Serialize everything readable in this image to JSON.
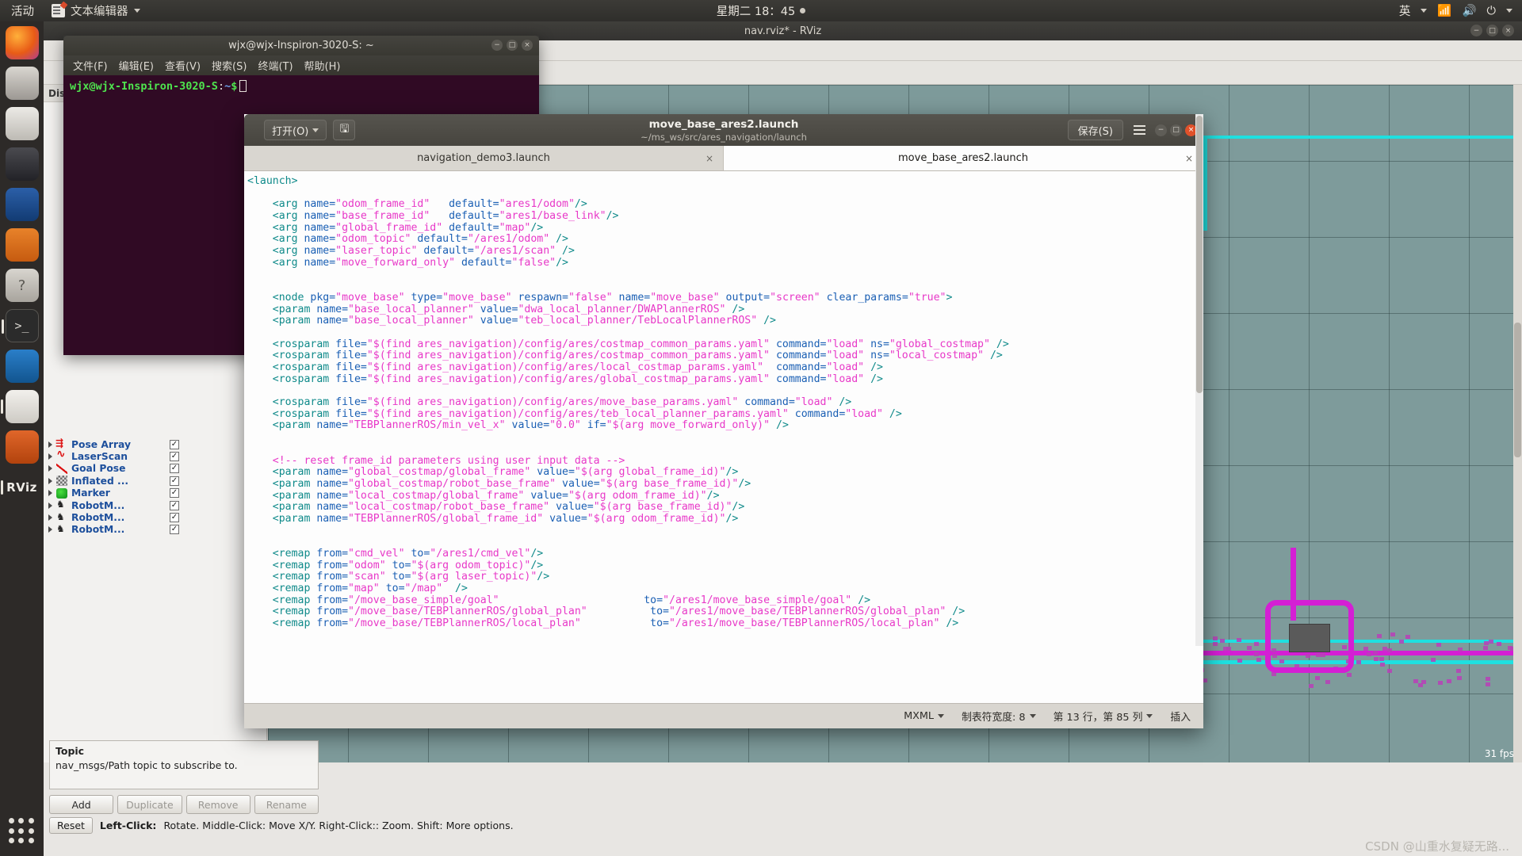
{
  "topbar": {
    "activities": "活动",
    "app_menu": "文本编辑器",
    "app_icon": "text-editor-icon",
    "clock": "星期二 18：45",
    "tray": {
      "input_method": "英",
      "network_icon": "wifi-icon",
      "volume_icon": "volume-icon",
      "power_icon": "power-icon"
    }
  },
  "dock": {
    "items": [
      {
        "name": "firefox",
        "label": "Firefox"
      },
      {
        "name": "thunderbird",
        "label": "Thunderbird Mail"
      },
      {
        "name": "files",
        "label": "Files"
      },
      {
        "name": "rhythmbox",
        "label": "Rhythmbox"
      },
      {
        "name": "libreoffice-writer",
        "label": "LibreOffice Writer"
      },
      {
        "name": "ubuntu-software",
        "label": "Ubuntu Software"
      },
      {
        "name": "help",
        "label": "Help"
      },
      {
        "name": "terminal",
        "label": "Terminal"
      },
      {
        "name": "vscode",
        "label": "Visual Studio Code"
      },
      {
        "name": "gedit",
        "label": "Text Editor"
      },
      {
        "name": "rviz-3d",
        "label": "RViz"
      },
      {
        "name": "rviz-label",
        "label": "RViz"
      }
    ],
    "show_apps": "Show Applications"
  },
  "rviz": {
    "title": "nav.rviz* - RViz",
    "window_buttons": [
      "−",
      "□",
      "×"
    ],
    "displays_header": "Displays",
    "displays": [
      {
        "label": "Pose Array",
        "icon": "pose-array-icon",
        "checked": true
      },
      {
        "label": "LaserScan",
        "icon": "laserscan-icon",
        "checked": true
      },
      {
        "label": "Goal Pose",
        "icon": "goal-pose-icon",
        "checked": true
      },
      {
        "label": "Inflated ...",
        "icon": "inflated-map-icon",
        "checked": true
      },
      {
        "label": "Marker",
        "icon": "marker-icon",
        "checked": true
      },
      {
        "label": "RobotM...",
        "icon": "robot-model-icon",
        "checked": true
      },
      {
        "label": "RobotM...",
        "icon": "robot-model-icon",
        "checked": true
      },
      {
        "label": "RobotM...",
        "icon": "robot-model-icon",
        "checked": true
      }
    ],
    "description": {
      "title": "Topic",
      "text": "nav_msgs/Path topic to subscribe to."
    },
    "buttons": {
      "add": "Add",
      "duplicate": "Duplicate",
      "remove": "Remove",
      "rename": "Rename"
    },
    "statusbar": {
      "reset": "Reset",
      "hints_bold": "Left-Click:",
      "hints": "Rotate.  Middle-Click: Move X/Y.  Right-Click:: Zoom.  Shift: More options."
    },
    "fps": "31 fps",
    "watermark": "CSDN @山重水复疑无路..."
  },
  "terminal": {
    "title": "wjx@wjx-Inspiron-3020-S: ~",
    "menu": [
      "文件(F)",
      "编辑(E)",
      "查看(V)",
      "搜索(S)",
      "终端(T)",
      "帮助(H)"
    ],
    "window_buttons": [
      "−",
      "□",
      "×"
    ],
    "prompt_user": "wjx@wjx-Inspiron-3020-S",
    "prompt_sep": ":",
    "prompt_path": "~",
    "prompt_dollar": "$"
  },
  "gedit": {
    "open_button": "打开(O)",
    "save_icon": "save-icon",
    "save_button": "保存(S)",
    "menu_icon": "hamburger-menu-icon",
    "title": "move_base_ares2.launch",
    "subtitle": "~/ms_ws/src/ares_navigation/launch",
    "window_buttons": [
      "−",
      "□",
      "×"
    ],
    "tabs": [
      {
        "label": "navigation_demo3.launch",
        "active": false,
        "close": "×"
      },
      {
        "label": "move_base_ares2.launch",
        "active": true,
        "close": "×"
      }
    ],
    "status": {
      "language": "MXML",
      "tab_width": "制表符宽度: 8",
      "position": "第 13 行，第 85 列",
      "insert_mode": "插入"
    },
    "code_lines": [
      [
        [
          "<launch>",
          "k-tag"
        ]
      ],
      [],
      [
        [
          "    <arg ",
          "k-tag"
        ],
        [
          "name=",
          "k-name"
        ],
        [
          "\"odom_frame_id\"",
          "k-val"
        ],
        [
          "   ",
          "k-plain"
        ],
        [
          "default=",
          "k-name"
        ],
        [
          "\"ares1/odom\"",
          "k-val"
        ],
        [
          "/>",
          "k-tag"
        ]
      ],
      [
        [
          "    <arg ",
          "k-tag"
        ],
        [
          "name=",
          "k-name"
        ],
        [
          "\"base_frame_id\"",
          "k-val"
        ],
        [
          "   ",
          "k-plain"
        ],
        [
          "default=",
          "k-name"
        ],
        [
          "\"ares1/base_link\"",
          "k-val"
        ],
        [
          "/>",
          "k-tag"
        ]
      ],
      [
        [
          "    <arg ",
          "k-tag"
        ],
        [
          "name=",
          "k-name"
        ],
        [
          "\"global_frame_id\"",
          "k-val"
        ],
        [
          " ",
          "k-plain"
        ],
        [
          "default=",
          "k-name"
        ],
        [
          "\"map\"",
          "k-val"
        ],
        [
          "/>",
          "k-tag"
        ]
      ],
      [
        [
          "    <arg ",
          "k-tag"
        ],
        [
          "name=",
          "k-name"
        ],
        [
          "\"odom_topic\"",
          "k-val"
        ],
        [
          " ",
          "k-plain"
        ],
        [
          "default=",
          "k-name"
        ],
        [
          "\"/ares1/odom\"",
          "k-val"
        ],
        [
          " />",
          "k-tag"
        ]
      ],
      [
        [
          "    <arg ",
          "k-tag"
        ],
        [
          "name=",
          "k-name"
        ],
        [
          "\"laser_topic\"",
          "k-val"
        ],
        [
          " ",
          "k-plain"
        ],
        [
          "default=",
          "k-name"
        ],
        [
          "\"/ares1/scan\"",
          "k-val"
        ],
        [
          " />",
          "k-tag"
        ]
      ],
      [
        [
          "    <arg ",
          "k-tag"
        ],
        [
          "name=",
          "k-name"
        ],
        [
          "\"move_forward_only\"",
          "k-val"
        ],
        [
          " ",
          "k-plain"
        ],
        [
          "default=",
          "k-name"
        ],
        [
          "\"false\"",
          "k-val"
        ],
        [
          "/>",
          "k-tag"
        ]
      ],
      [],
      [],
      [
        [
          "    <node ",
          "k-tag"
        ],
        [
          "pkg=",
          "k-name"
        ],
        [
          "\"move_base\"",
          "k-val"
        ],
        [
          " ",
          "k-plain"
        ],
        [
          "type=",
          "k-name"
        ],
        [
          "\"move_base\"",
          "k-val"
        ],
        [
          " ",
          "k-plain"
        ],
        [
          "respawn=",
          "k-name"
        ],
        [
          "\"false\"",
          "k-val"
        ],
        [
          " ",
          "k-plain"
        ],
        [
          "name=",
          "k-name"
        ],
        [
          "\"move_base\"",
          "k-val"
        ],
        [
          " ",
          "k-plain"
        ],
        [
          "output=",
          "k-name"
        ],
        [
          "\"screen\"",
          "k-val"
        ],
        [
          " ",
          "k-plain"
        ],
        [
          "clear_params=",
          "k-name"
        ],
        [
          "\"true\"",
          "k-val"
        ],
        [
          ">",
          "k-tag"
        ]
      ],
      [
        [
          "    <param ",
          "k-tag"
        ],
        [
          "name=",
          "k-name"
        ],
        [
          "\"base_local_planner\"",
          "k-val"
        ],
        [
          " ",
          "k-plain"
        ],
        [
          "value=",
          "k-name"
        ],
        [
          "\"dwa_local_planner/DWAPlannerROS\"",
          "k-val"
        ],
        [
          " />",
          "k-tag"
        ]
      ],
      [
        [
          "    <param ",
          "k-tag"
        ],
        [
          "name=",
          "k-name"
        ],
        [
          "\"base_local_planner\"",
          "k-val"
        ],
        [
          " ",
          "k-plain"
        ],
        [
          "value=",
          "k-name"
        ],
        [
          "\"teb_local_planner/TebLocalPlannerROS\"",
          "k-val"
        ],
        [
          " />",
          "k-tag"
        ]
      ],
      [],
      [
        [
          "    <rosparam ",
          "k-tag"
        ],
        [
          "file=",
          "k-name"
        ],
        [
          "\"$(find ares_navigation)/config/ares/costmap_common_params.yaml\"",
          "k-val"
        ],
        [
          " ",
          "k-plain"
        ],
        [
          "command=",
          "k-name"
        ],
        [
          "\"load\"",
          "k-val"
        ],
        [
          " ",
          "k-plain"
        ],
        [
          "ns=",
          "k-name"
        ],
        [
          "\"global_costmap\"",
          "k-val"
        ],
        [
          " />",
          "k-tag"
        ]
      ],
      [
        [
          "    <rosparam ",
          "k-tag"
        ],
        [
          "file=",
          "k-name"
        ],
        [
          "\"$(find ares_navigation)/config/ares/costmap_common_params.yaml\"",
          "k-val"
        ],
        [
          " ",
          "k-plain"
        ],
        [
          "command=",
          "k-name"
        ],
        [
          "\"load\"",
          "k-val"
        ],
        [
          " ",
          "k-plain"
        ],
        [
          "ns=",
          "k-name"
        ],
        [
          "\"local_costmap\"",
          "k-val"
        ],
        [
          " />",
          "k-tag"
        ]
      ],
      [
        [
          "    <rosparam ",
          "k-tag"
        ],
        [
          "file=",
          "k-name"
        ],
        [
          "\"$(find ares_navigation)/config/ares/local_costmap_params.yaml\"",
          "k-val"
        ],
        [
          "  ",
          "k-plain"
        ],
        [
          "command=",
          "k-name"
        ],
        [
          "\"load\"",
          "k-val"
        ],
        [
          " />",
          "k-tag"
        ]
      ],
      [
        [
          "    <rosparam ",
          "k-tag"
        ],
        [
          "file=",
          "k-name"
        ],
        [
          "\"$(find ares_navigation)/config/ares/global_costmap_params.yaml\"",
          "k-val"
        ],
        [
          " ",
          "k-plain"
        ],
        [
          "command=",
          "k-name"
        ],
        [
          "\"load\"",
          "k-val"
        ],
        [
          " />",
          "k-tag"
        ]
      ],
      [],
      [
        [
          "    <rosparam ",
          "k-tag"
        ],
        [
          "file=",
          "k-name"
        ],
        [
          "\"$(find ares_navigation)/config/ares/move_base_params.yaml\"",
          "k-val"
        ],
        [
          " ",
          "k-plain"
        ],
        [
          "command=",
          "k-name"
        ],
        [
          "\"load\"",
          "k-val"
        ],
        [
          " />",
          "k-tag"
        ]
      ],
      [
        [
          "    <rosparam ",
          "k-tag"
        ],
        [
          "file=",
          "k-name"
        ],
        [
          "\"$(find ares_navigation)/config/ares/teb_local_planner_params.yaml\"",
          "k-val"
        ],
        [
          " ",
          "k-plain"
        ],
        [
          "command=",
          "k-name"
        ],
        [
          "\"load\"",
          "k-val"
        ],
        [
          " />",
          "k-tag"
        ]
      ],
      [
        [
          "    <param ",
          "k-tag"
        ],
        [
          "name=",
          "k-name"
        ],
        [
          "\"TEBPlannerROS/min_vel_x\"",
          "k-val"
        ],
        [
          " ",
          "k-plain"
        ],
        [
          "value=",
          "k-name"
        ],
        [
          "\"0.0\"",
          "k-val"
        ],
        [
          " ",
          "k-plain"
        ],
        [
          "if=",
          "k-name"
        ],
        [
          "\"$(arg move_forward_only)\"",
          "k-val"
        ],
        [
          " />",
          "k-tag"
        ]
      ],
      [],
      [],
      [
        [
          "    <!-- reset frame_id parameters using user input data -->",
          "k-cmt"
        ]
      ],
      [
        [
          "    <param ",
          "k-tag"
        ],
        [
          "name=",
          "k-name"
        ],
        [
          "\"global_costmap/global_frame\"",
          "k-val"
        ],
        [
          " ",
          "k-plain"
        ],
        [
          "value=",
          "k-name"
        ],
        [
          "\"$(arg global_frame_id)\"",
          "k-val"
        ],
        [
          "/>",
          "k-tag"
        ]
      ],
      [
        [
          "    <param ",
          "k-tag"
        ],
        [
          "name=",
          "k-name"
        ],
        [
          "\"global_costmap/robot_base_frame\"",
          "k-val"
        ],
        [
          " ",
          "k-plain"
        ],
        [
          "value=",
          "k-name"
        ],
        [
          "\"$(arg base_frame_id)\"",
          "k-val"
        ],
        [
          "/>",
          "k-tag"
        ]
      ],
      [
        [
          "    <param ",
          "k-tag"
        ],
        [
          "name=",
          "k-name"
        ],
        [
          "\"local_costmap/global_frame\"",
          "k-val"
        ],
        [
          " ",
          "k-plain"
        ],
        [
          "value=",
          "k-name"
        ],
        [
          "\"$(arg odom_frame_id)\"",
          "k-val"
        ],
        [
          "/>",
          "k-tag"
        ]
      ],
      [
        [
          "    <param ",
          "k-tag"
        ],
        [
          "name=",
          "k-name"
        ],
        [
          "\"local_costmap/robot_base_frame\"",
          "k-val"
        ],
        [
          " ",
          "k-plain"
        ],
        [
          "value=",
          "k-name"
        ],
        [
          "\"$(arg base_frame_id)\"",
          "k-val"
        ],
        [
          "/>",
          "k-tag"
        ]
      ],
      [
        [
          "    <param ",
          "k-tag"
        ],
        [
          "name=",
          "k-name"
        ],
        [
          "\"TEBPlannerROS/global_frame_id\"",
          "k-val"
        ],
        [
          " ",
          "k-plain"
        ],
        [
          "value=",
          "k-name"
        ],
        [
          "\"$(arg odom_frame_id)\"",
          "k-val"
        ],
        [
          "/>",
          "k-tag"
        ]
      ],
      [],
      [],
      [
        [
          "    <remap ",
          "k-tag"
        ],
        [
          "from=",
          "k-name"
        ],
        [
          "\"cmd_vel\"",
          "k-val"
        ],
        [
          " ",
          "k-plain"
        ],
        [
          "to=",
          "k-name"
        ],
        [
          "\"/ares1/cmd_vel\"",
          "k-val"
        ],
        [
          "/>",
          "k-tag"
        ]
      ],
      [
        [
          "    <remap ",
          "k-tag"
        ],
        [
          "from=",
          "k-name"
        ],
        [
          "\"odom\"",
          "k-val"
        ],
        [
          " ",
          "k-plain"
        ],
        [
          "to=",
          "k-name"
        ],
        [
          "\"$(arg odom_topic)\"",
          "k-val"
        ],
        [
          "/>",
          "k-tag"
        ]
      ],
      [
        [
          "    <remap ",
          "k-tag"
        ],
        [
          "from=",
          "k-name"
        ],
        [
          "\"scan\"",
          "k-val"
        ],
        [
          " ",
          "k-plain"
        ],
        [
          "to=",
          "k-name"
        ],
        [
          "\"$(arg laser_topic)\"",
          "k-val"
        ],
        [
          "/>",
          "k-tag"
        ]
      ],
      [
        [
          "    <remap ",
          "k-tag"
        ],
        [
          "from=",
          "k-name"
        ],
        [
          "\"map\"",
          "k-val"
        ],
        [
          " ",
          "k-plain"
        ],
        [
          "to=",
          "k-name"
        ],
        [
          "\"/map\"",
          "k-val"
        ],
        [
          "  />",
          "k-tag"
        ]
      ],
      [
        [
          "    <remap ",
          "k-tag"
        ],
        [
          "from=",
          "k-name"
        ],
        [
          "\"/move_base_simple/goal\"",
          "k-val"
        ],
        [
          "                       ",
          "k-plain"
        ],
        [
          "to=",
          "k-name"
        ],
        [
          "\"/ares1/move_base_simple/goal\"",
          "k-val"
        ],
        [
          " />",
          "k-tag"
        ]
      ],
      [
        [
          "    <remap ",
          "k-tag"
        ],
        [
          "from=",
          "k-name"
        ],
        [
          "\"/move_base/TEBPlannerROS/global_plan\"",
          "k-val"
        ],
        [
          "          ",
          "k-plain"
        ],
        [
          "to=",
          "k-name"
        ],
        [
          "\"/ares1/move_base/TEBPlannerROS/global_plan\"",
          "k-val"
        ],
        [
          " />",
          "k-tag"
        ]
      ],
      [
        [
          "    <remap ",
          "k-tag"
        ],
        [
          "from=",
          "k-name"
        ],
        [
          "\"/move_base/TEBPlannerROS/local_plan\"",
          "k-val"
        ],
        [
          "           ",
          "k-plain"
        ],
        [
          "to=",
          "k-name"
        ],
        [
          "\"/ares1/move_base/TEBPlannerROS/local_plan\"",
          "k-val"
        ],
        [
          " />",
          "k-tag"
        ]
      ]
    ]
  }
}
